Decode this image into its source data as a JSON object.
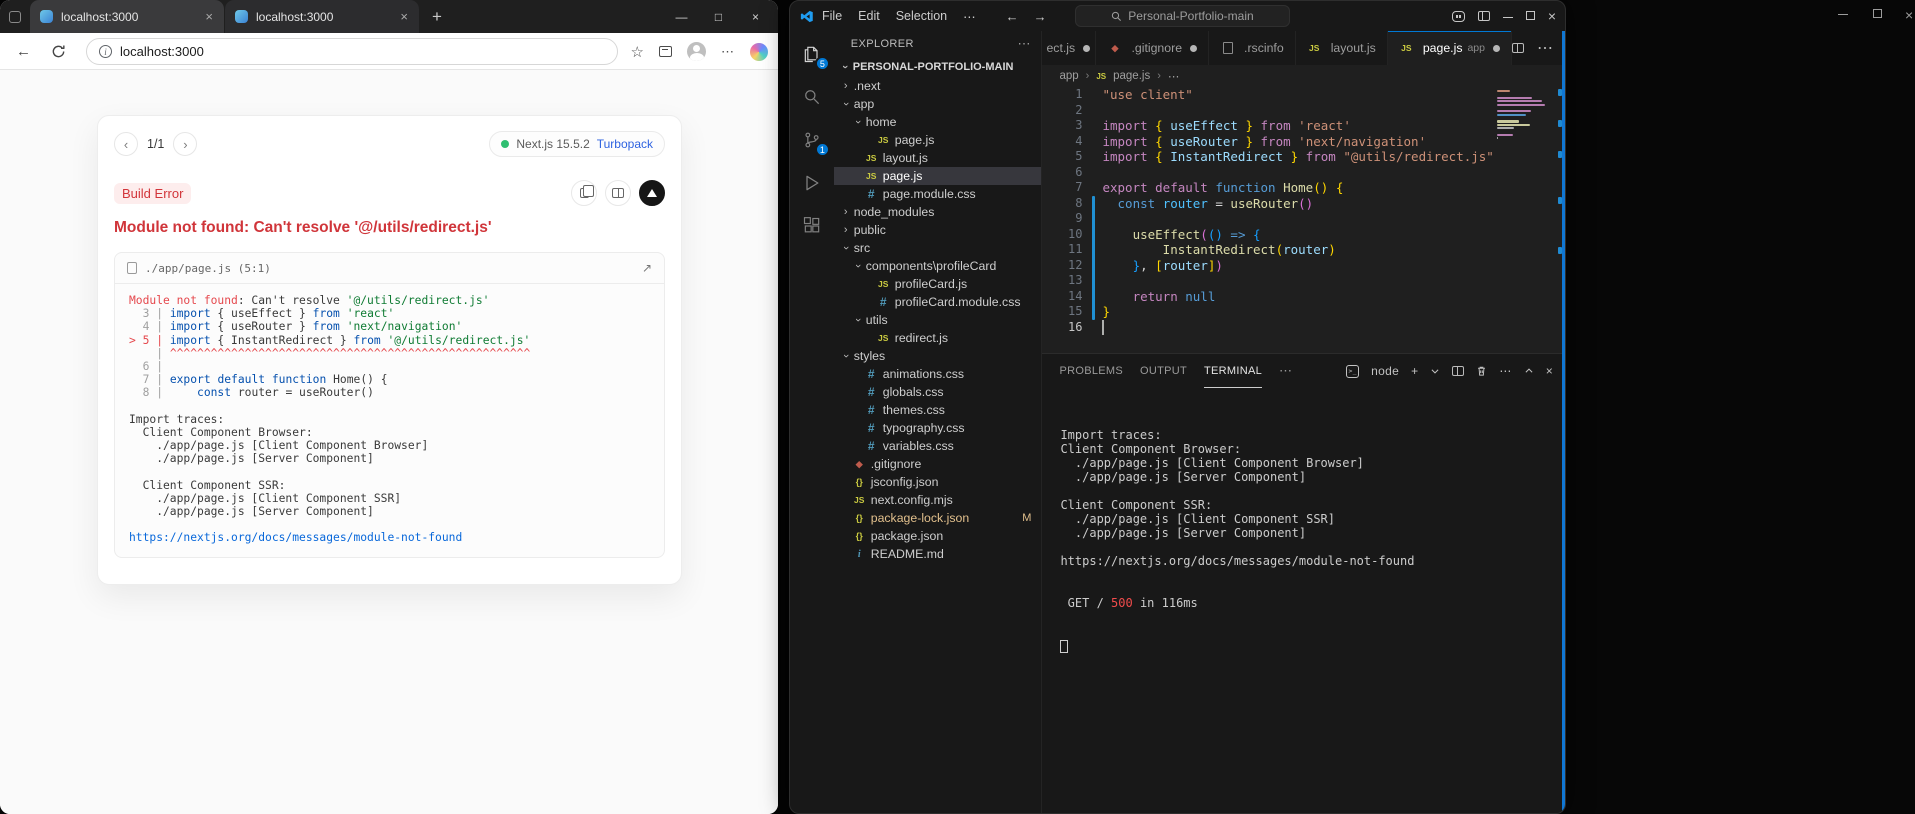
{
  "browser": {
    "tabs": [
      {
        "title": "localhost:3000"
      },
      {
        "title": "localhost:3000"
      }
    ],
    "address": "localhost:3000",
    "overlay": {
      "pagination": "1/1",
      "prev_label": "‹",
      "next_label": "›",
      "version": "Next.js 15.5.2",
      "bundler": "Turbopack",
      "error_type": "Build Error",
      "title": "Module not found: Can't resolve '@/utils/redirect.js'",
      "frame_file": "./app/page.js (5:1)",
      "frame_lines": [
        [
          {
            "t": "Module not found",
            "c": "e"
          },
          {
            "t": ": Can't resolve ",
            "c": "p"
          },
          {
            "t": "'@/utils/redirect.js'",
            "c": "s"
          }
        ],
        [
          {
            "t": "  3 | ",
            "c": "g"
          },
          {
            "t": "import",
            "c": "k"
          },
          {
            "t": " { ",
            "c": "p"
          },
          {
            "t": "useEffect",
            "c": "p"
          },
          {
            "t": " } ",
            "c": "p"
          },
          {
            "t": "from",
            "c": "k"
          },
          {
            "t": " ",
            "c": "p"
          },
          {
            "t": "'react'",
            "c": "s"
          }
        ],
        [
          {
            "t": "  4 | ",
            "c": "g"
          },
          {
            "t": "import",
            "c": "k"
          },
          {
            "t": " { ",
            "c": "p"
          },
          {
            "t": "useRouter",
            "c": "p"
          },
          {
            "t": " } ",
            "c": "p"
          },
          {
            "t": "from",
            "c": "k"
          },
          {
            "t": " ",
            "c": "p"
          },
          {
            "t": "'next/navigation'",
            "c": "s"
          }
        ],
        [
          {
            "t": "> 5 | ",
            "c": "e"
          },
          {
            "t": "import",
            "c": "k"
          },
          {
            "t": " { ",
            "c": "p"
          },
          {
            "t": "InstantRedirect",
            "c": "p"
          },
          {
            "t": " } ",
            "c": "p"
          },
          {
            "t": "from",
            "c": "k"
          },
          {
            "t": " ",
            "c": "p"
          },
          {
            "t": "'@/utils/redirect.js'",
            "c": "s"
          }
        ],
        [
          {
            "t": "    | ",
            "c": "g"
          },
          {
            "t": "^^^^^^^^^^^^^^^^^^^^^^^^^^^^^^^^^^^^^^^^^^^^^^^^^^^^^",
            "c": "e"
          }
        ],
        [
          {
            "t": "  6 |",
            "c": "g"
          }
        ],
        [
          {
            "t": "  7 | ",
            "c": "g"
          },
          {
            "t": "export",
            "c": "k"
          },
          {
            "t": " ",
            "c": "p"
          },
          {
            "t": "default",
            "c": "k"
          },
          {
            "t": " ",
            "c": "p"
          },
          {
            "t": "function",
            "c": "k"
          },
          {
            "t": " ",
            "c": "p"
          },
          {
            "t": "Home",
            "c": "p"
          },
          {
            "t": "() {",
            "c": "p"
          }
        ],
        [
          {
            "t": "  8 | ",
            "c": "g"
          },
          {
            "t": "    ",
            "c": "p"
          },
          {
            "t": "const",
            "c": "k"
          },
          {
            "t": " router = useRouter()",
            "c": "p"
          }
        ],
        [],
        [
          {
            "t": "Import traces:",
            "c": "p"
          }
        ],
        [
          {
            "t": "  Client Component Browser:",
            "c": "p"
          }
        ],
        [
          {
            "t": "    ./app/page.js [Client Component Browser]",
            "c": "p"
          }
        ],
        [
          {
            "t": "    ./app/page.js [Server Component]",
            "c": "p"
          }
        ],
        [],
        [
          {
            "t": "  Client Component SSR:",
            "c": "p"
          }
        ],
        [
          {
            "t": "    ./app/page.js [Client Component SSR]",
            "c": "p"
          }
        ],
        [
          {
            "t": "    ./app/page.js [Server Component]",
            "c": "p"
          }
        ],
        [],
        [
          {
            "t": "https://nextjs.org/docs/messages/module-not-found",
            "c": "l"
          }
        ]
      ]
    }
  },
  "vscode": {
    "title_menus": [
      "File",
      "Edit",
      "Selection"
    ],
    "command_center": "Personal-Portfolio-main",
    "activity": {
      "explorer_badge": "5",
      "scm_badge": "1"
    },
    "explorer": {
      "title": "EXPLORER",
      "root": "PERSONAL-PORTFOLIO-MAIN",
      "items": [
        {
          "label": ".next",
          "type": "folder",
          "state": "collapsed",
          "level": 1
        },
        {
          "label": "app",
          "type": "folder",
          "state": "expanded",
          "level": 1
        },
        {
          "label": "home",
          "type": "folder",
          "state": "expanded",
          "level": 2
        },
        {
          "label": "page.js",
          "type": "file",
          "icon": "js",
          "level": 3
        },
        {
          "label": "layout.js",
          "type": "file",
          "icon": "js",
          "level": 2
        },
        {
          "label": "page.js",
          "type": "file",
          "icon": "js",
          "level": 2,
          "selected": true
        },
        {
          "label": "page.module.css",
          "type": "file",
          "icon": "css",
          "level": 2
        },
        {
          "label": "node_modules",
          "type": "folder",
          "state": "collapsed",
          "level": 1
        },
        {
          "label": "public",
          "type": "folder",
          "state": "collapsed",
          "level": 1
        },
        {
          "label": "src",
          "type": "folder",
          "state": "expanded",
          "level": 1
        },
        {
          "label": "components\\profileCard",
          "type": "folder",
          "state": "expanded",
          "level": 2
        },
        {
          "label": "profileCard.js",
          "type": "file",
          "icon": "js",
          "level": 3
        },
        {
          "label": "profileCard.module.css",
          "type": "file",
          "icon": "css",
          "level": 3
        },
        {
          "label": "utils",
          "type": "folder",
          "state": "expanded",
          "level": 2
        },
        {
          "label": "redirect.js",
          "type": "file",
          "icon": "js",
          "level": 3
        },
        {
          "label": "styles",
          "type": "folder",
          "state": "expanded",
          "level": 1
        },
        {
          "label": "animations.css",
          "type": "file",
          "icon": "css",
          "level": 2
        },
        {
          "label": "globals.css",
          "type": "file",
          "icon": "css",
          "level": 2
        },
        {
          "label": "themes.css",
          "type": "file",
          "icon": "css",
          "level": 2
        },
        {
          "label": "typography.css",
          "type": "file",
          "icon": "css",
          "level": 2
        },
        {
          "label": "variables.css",
          "type": "file",
          "icon": "css",
          "level": 2
        },
        {
          "label": ".gitignore",
          "type": "file",
          "icon": "git",
          "level": 1
        },
        {
          "label": "jsconfig.json",
          "type": "file",
          "icon": "json",
          "level": 1
        },
        {
          "label": "next.config.mjs",
          "type": "file",
          "icon": "js",
          "level": 1
        },
        {
          "label": "package-lock.json",
          "type": "file",
          "icon": "json",
          "level": 1,
          "badge": "M",
          "modified": true
        },
        {
          "label": "package.json",
          "type": "file",
          "icon": "json",
          "level": 1
        },
        {
          "label": "README.md",
          "type": "file",
          "icon": "info",
          "level": 1
        }
      ]
    },
    "editor_tabs": [
      {
        "label": "ect.js",
        "icon": "js",
        "modified": true,
        "partial": true
      },
      {
        "label": ".gitignore",
        "icon": "git",
        "modified": true
      },
      {
        "label": ".rscinfo",
        "icon": "file",
        "modified": false
      },
      {
        "label": "layout.js",
        "icon": "js",
        "modified": false
      },
      {
        "label": "page.js",
        "icon": "js",
        "dir": "app",
        "modified": true,
        "active": true
      }
    ],
    "breadcrumb": [
      "app",
      "page.js",
      "⋯"
    ],
    "editor": {
      "active_line": 16,
      "modified_range": [
        8,
        15
      ],
      "lines": [
        [
          {
            "t": "\"use client\"",
            "c": "s"
          }
        ],
        [],
        [
          {
            "t": "import",
            "c": "k"
          },
          {
            "t": " ",
            "c": "p"
          },
          {
            "t": "{",
            "c": "b1"
          },
          {
            "t": " useEffect ",
            "c": "v"
          },
          {
            "t": "}",
            "c": "b1"
          },
          {
            "t": " ",
            "c": "p"
          },
          {
            "t": "from",
            "c": "k"
          },
          {
            "t": " ",
            "c": "p"
          },
          {
            "t": "'react'",
            "c": "s"
          }
        ],
        [
          {
            "t": "import",
            "c": "k"
          },
          {
            "t": " ",
            "c": "p"
          },
          {
            "t": "{",
            "c": "b1"
          },
          {
            "t": " useRouter ",
            "c": "v"
          },
          {
            "t": "}",
            "c": "b1"
          },
          {
            "t": " ",
            "c": "p"
          },
          {
            "t": "from",
            "c": "k"
          },
          {
            "t": " ",
            "c": "p"
          },
          {
            "t": "'next/navigation'",
            "c": "s"
          }
        ],
        [
          {
            "t": "import",
            "c": "k"
          },
          {
            "t": " ",
            "c": "p"
          },
          {
            "t": "{",
            "c": "b1"
          },
          {
            "t": " InstantRedirect ",
            "c": "v"
          },
          {
            "t": "}",
            "c": "b1"
          },
          {
            "t": " ",
            "c": "p"
          },
          {
            "t": "from",
            "c": "k"
          },
          {
            "t": " ",
            "c": "p"
          },
          {
            "t": "\"@utils/redirect.js\"",
            "c": "s"
          }
        ],
        [],
        [
          {
            "t": "export",
            "c": "k"
          },
          {
            "t": " ",
            "c": "p"
          },
          {
            "t": "default",
            "c": "k"
          },
          {
            "t": " ",
            "c": "p"
          },
          {
            "t": "function",
            "c": "kb"
          },
          {
            "t": " ",
            "c": "p"
          },
          {
            "t": "Home",
            "c": "f"
          },
          {
            "t": "()",
            "c": "b1"
          },
          {
            "t": " ",
            "c": "p"
          },
          {
            "t": "{",
            "c": "b1"
          }
        ],
        [
          {
            "t": "  ",
            "c": "p"
          },
          {
            "t": "const",
            "c": "kb"
          },
          {
            "t": " ",
            "c": "p"
          },
          {
            "t": "router",
            "c": "cv"
          },
          {
            "t": " = ",
            "c": "p"
          },
          {
            "t": "useRouter",
            "c": "f"
          },
          {
            "t": "()",
            "c": "b2"
          }
        ],
        [],
        [
          {
            "t": "    ",
            "c": "p"
          },
          {
            "t": "useEffect",
            "c": "f"
          },
          {
            "t": "(",
            "c": "b2"
          },
          {
            "t": "()",
            "c": "b3"
          },
          {
            "t": " ",
            "c": "p"
          },
          {
            "t": "=>",
            "c": "kb"
          },
          {
            "t": " ",
            "c": "p"
          },
          {
            "t": "{",
            "c": "b3"
          }
        ],
        [
          {
            "t": "        ",
            "c": "p"
          },
          {
            "t": "InstantRedirect",
            "c": "f"
          },
          {
            "t": "(",
            "c": "b1"
          },
          {
            "t": "router",
            "c": "v"
          },
          {
            "t": ")",
            "c": "b1"
          }
        ],
        [
          {
            "t": "    ",
            "c": "p"
          },
          {
            "t": "}",
            "c": "b3"
          },
          {
            "t": ", ",
            "c": "p"
          },
          {
            "t": "[",
            "c": "b1"
          },
          {
            "t": "router",
            "c": "v"
          },
          {
            "t": "]",
            "c": "b1"
          },
          {
            "t": ")",
            "c": "b2"
          }
        ],
        [],
        [
          {
            "t": "    ",
            "c": "p"
          },
          {
            "t": "return",
            "c": "k"
          },
          {
            "t": " ",
            "c": "p"
          },
          {
            "t": "null",
            "c": "kb"
          }
        ],
        [
          {
            "t": "}",
            "c": "b1"
          }
        ],
        []
      ]
    },
    "panel": {
      "tabs": [
        "PROBLEMS",
        "OUTPUT",
        "TERMINAL"
      ],
      "profile": "node",
      "terminal_lines": [
        [
          {
            "t": "Import traces:"
          }
        ],
        [
          {
            "t": "Client Component Browser:"
          }
        ],
        [
          {
            "t": "  ./app/page.js [Client Component Browser]"
          }
        ],
        [
          {
            "t": "  ./app/page.js [Server Component]"
          }
        ],
        [],
        [
          {
            "t": "Client Component SSR:"
          }
        ],
        [
          {
            "t": "  ./app/page.js [Client Component SSR]"
          }
        ],
        [
          {
            "t": "  ./app/page.js [Server Component]"
          }
        ],
        [],
        [
          {
            "t": "https://nextjs.org/docs/messages/module-not-found"
          }
        ],
        [],
        [],
        [
          {
            "t": " GET / "
          },
          {
            "t": "500",
            "c": "r"
          },
          {
            "t": " in 116ms"
          }
        ]
      ]
    }
  }
}
